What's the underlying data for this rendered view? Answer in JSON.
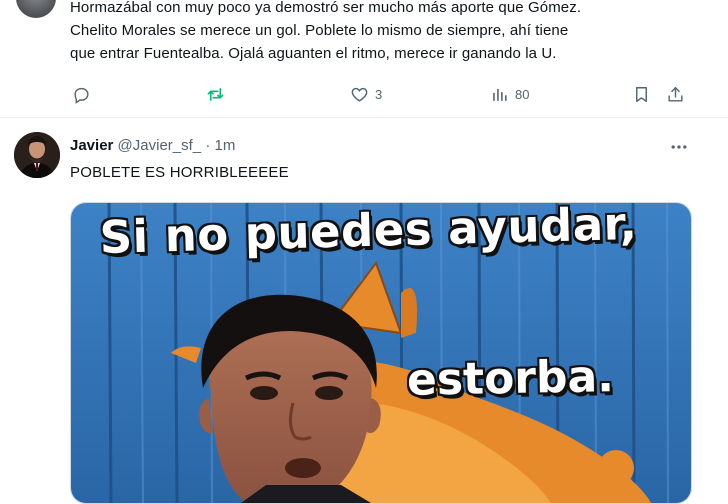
{
  "top_tweet": {
    "text_lines": [
      "Hormazábal con muy poco ya demostró ser mucho más aporte que Gómez.",
      "Chelito Morales se merece un gol. Poblete lo mismo de siempre, ahí tiene",
      "que entrar Fuentealba. Ojalá aguanten el ritmo, merece ir ganando la U."
    ],
    "actions": {
      "reply_icon": "reply-icon",
      "retweet_icon": "retweet-icon",
      "like_icon": "heart-icon",
      "like_count": "3",
      "views_icon": "views-icon",
      "views_count": "80",
      "bookmark_icon": "bookmark-icon",
      "share_icon": "share-icon"
    }
  },
  "tweet": {
    "author_name": "Javier",
    "handle": "@Javier_sf_",
    "separator": "·",
    "time": "1m",
    "text": "POBLETE ES HORRIBLEEEEE",
    "more_icon": "more-icon",
    "meme": {
      "top_text": "Si no puedes ayudar,",
      "bottom_text": "estorba."
    }
  },
  "colors": {
    "text": "#0f1419",
    "secondary": "#536471",
    "retweet_active": "#00ba7c",
    "meme_background": "#2f6fb0"
  }
}
